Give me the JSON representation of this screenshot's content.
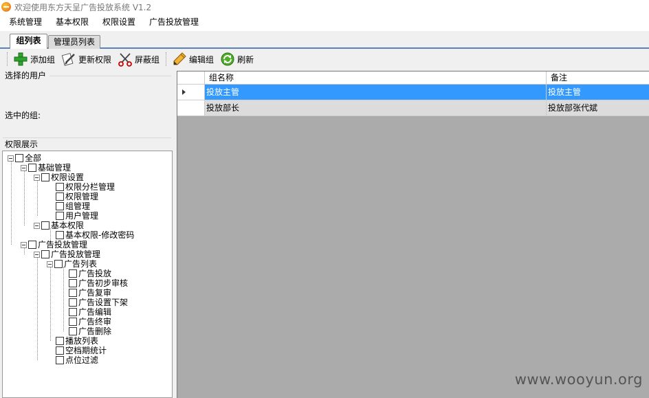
{
  "window": {
    "title": "欢迎使用东方天呈广告投放系统 V1.2"
  },
  "menu": [
    "系统管理",
    "基本权限",
    "权限设置",
    "广告投放管理"
  ],
  "tabs": [
    "组列表",
    "管理员列表"
  ],
  "toolbar": {
    "add": "添加组",
    "update_perm": "更新权限",
    "block": "屏蔽组",
    "edit": "编辑组",
    "refresh": "刷新"
  },
  "left": {
    "selected_user_label": "选择的用户",
    "selected_group_label": "选中的组:",
    "perm_label": "权限展示"
  },
  "tree": {
    "root": "全部",
    "basic_mgmt": "基础管理",
    "perm_settings": "权限设置",
    "perm_column_mgmt": "权限分栏管理",
    "perm_mgmt": "权限管理",
    "group_mgmt": "组管理",
    "user_mgmt": "用户管理",
    "basic_perm": "基本权限",
    "basic_perm_pwd": "基本权限-修改密码",
    "ad_mgmt": "广告投放管理",
    "ad_mgmt_sub": "广告投放管理",
    "ad_list": "广告列表",
    "ad_place": "广告投放",
    "ad_initial_review": "广告初步审核",
    "ad_recheck": "广告复审",
    "ad_unlist": "广告设置下架",
    "ad_edit": "广告编辑",
    "ad_final": "广告终审",
    "ad_delete": "广告删除",
    "play_list": "播放列表",
    "vacancy_stats": "空档期统计",
    "slot_filter": "点位过滤"
  },
  "grid": {
    "columns": [
      "组名称",
      "备注"
    ],
    "rows": [
      [
        "投放主管",
        "投放主管"
      ],
      [
        "投放部长",
        "投放部张代斌"
      ]
    ]
  },
  "watermark": "www.wooyun.org"
}
